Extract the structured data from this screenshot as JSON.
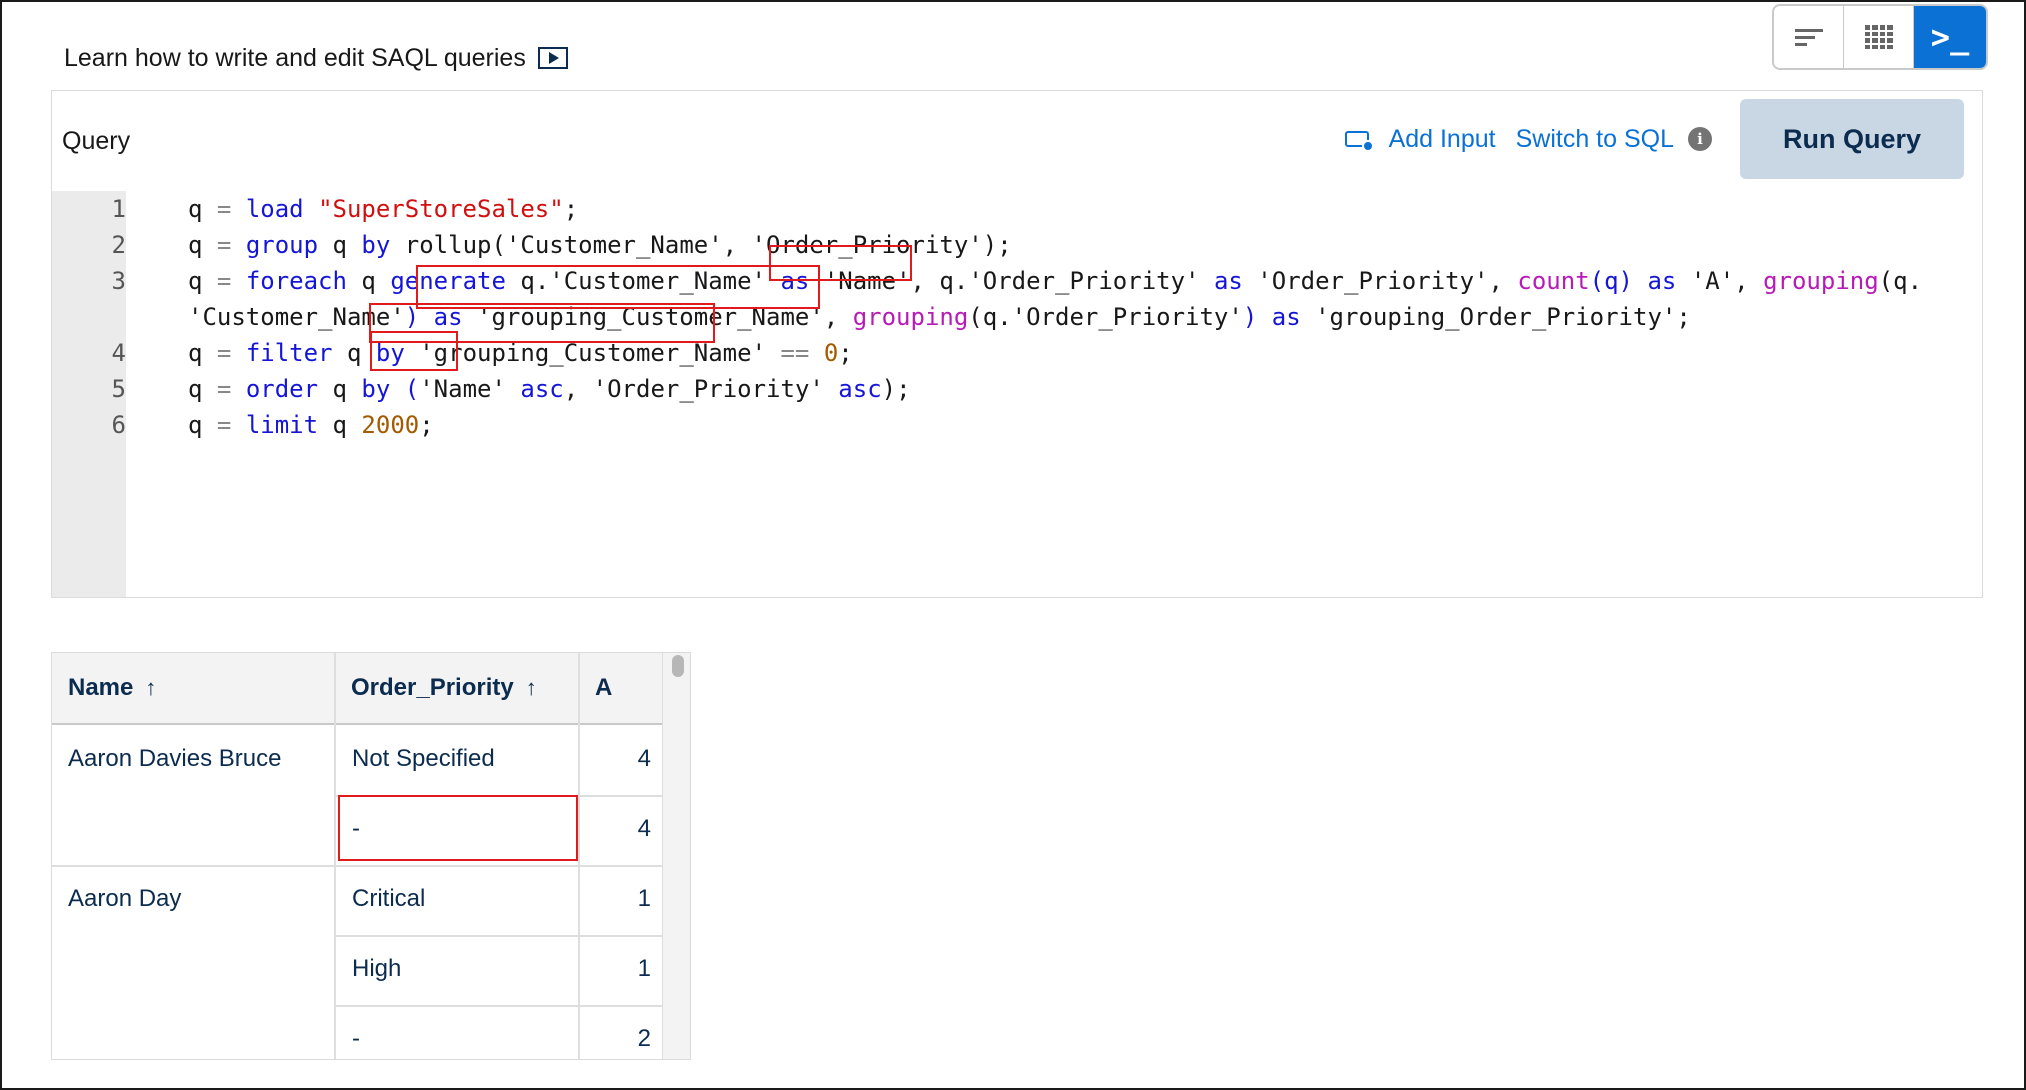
{
  "help": {
    "learn_text": "Learn how to write and edit SAQL queries"
  },
  "toggles": [
    {
      "icon": "sort-icon"
    },
    {
      "icon": "table-icon"
    },
    {
      "icon": "terminal-icon",
      "active": true
    }
  ],
  "query_panel": {
    "title": "Query",
    "add_input_label": "Add Input",
    "switch_sql_label": "Switch to SQL",
    "info_glyph": "i",
    "run_label": "Run Query"
  },
  "editor": {
    "line_numbers": [
      "1",
      "2",
      "3",
      "",
      "4",
      "5",
      "6"
    ],
    "lines": [
      [
        [
          "q ",
          ""
        ],
        [
          "=",
          "op"
        ],
        [
          " ",
          ""
        ],
        [
          "load",
          "kw"
        ],
        [
          " ",
          ""
        ],
        [
          "\"SuperStoreSales\"",
          "str"
        ],
        [
          ";",
          ""
        ]
      ],
      [
        [
          "q ",
          ""
        ],
        [
          "=",
          "op"
        ],
        [
          " ",
          ""
        ],
        [
          "group",
          "kw"
        ],
        [
          " q ",
          ""
        ],
        [
          "by",
          "kw"
        ],
        [
          " rollup('Customer_Name', 'Order_Priority');",
          ""
        ]
      ],
      [
        [
          "q ",
          ""
        ],
        [
          "=",
          "op"
        ],
        [
          " ",
          ""
        ],
        [
          "foreach",
          "kw"
        ],
        [
          " q ",
          ""
        ],
        [
          "generate",
          "kw"
        ],
        [
          " q.'Customer_Name' ",
          ""
        ],
        [
          "as",
          "kw"
        ],
        [
          " 'Name', q.'Order_Priority' ",
          ""
        ],
        [
          "as",
          "kw"
        ],
        [
          " 'Order_Priority', ",
          ""
        ],
        [
          "count",
          "fn"
        ],
        [
          "(q)",
          "kw"
        ],
        [
          " ",
          ""
        ],
        [
          "as",
          "kw"
        ],
        [
          " 'A', ",
          ""
        ],
        [
          "grouping",
          "fn"
        ],
        [
          "(q.",
          ""
        ]
      ],
      [
        [
          "'Customer_Name'",
          ""
        ],
        [
          ")",
          "kw"
        ],
        [
          " ",
          ""
        ],
        [
          "as",
          "kw"
        ],
        [
          " 'grouping_Customer_Name', ",
          ""
        ],
        [
          "grouping",
          "fn"
        ],
        [
          "(q.'Order_Priority'",
          ""
        ],
        [
          ")",
          "kw"
        ],
        [
          " ",
          ""
        ],
        [
          "as",
          "kw"
        ],
        [
          " 'grouping_Order_Priority';",
          ""
        ]
      ],
      [
        [
          "q ",
          ""
        ],
        [
          "=",
          "op"
        ],
        [
          " ",
          ""
        ],
        [
          "filter",
          "kw"
        ],
        [
          " q ",
          ""
        ],
        [
          "by",
          "kw"
        ],
        [
          " 'grouping_Customer_Name' ",
          ""
        ],
        [
          "==",
          "op"
        ],
        [
          " ",
          ""
        ],
        [
          "0",
          "num"
        ],
        [
          ";",
          ""
        ]
      ],
      [
        [
          "q ",
          ""
        ],
        [
          "=",
          "op"
        ],
        [
          " ",
          ""
        ],
        [
          "order",
          "kw"
        ],
        [
          " q ",
          ""
        ],
        [
          "by",
          "kw"
        ],
        [
          " ",
          ""
        ],
        [
          "(",
          "kw"
        ],
        [
          "'Name' ",
          ""
        ],
        [
          "asc",
          "kw"
        ],
        [
          ", 'Order_Priority' ",
          ""
        ],
        [
          "asc",
          "kw"
        ],
        [
          ");",
          ""
        ]
      ],
      [
        [
          "q ",
          ""
        ],
        [
          "=",
          "op"
        ],
        [
          " ",
          ""
        ],
        [
          "limit",
          "kw"
        ],
        [
          " q ",
          ""
        ],
        [
          "2000",
          "num"
        ],
        [
          ";",
          ""
        ]
      ]
    ]
  },
  "results": {
    "columns": [
      {
        "label": "Name",
        "sort": "↑"
      },
      {
        "label": "Order_Priority",
        "sort": "↑"
      },
      {
        "label": "A",
        "sort": ""
      }
    ],
    "groups": [
      {
        "name": "Aaron Davies Bruce",
        "rows": [
          {
            "priority": "Not Specified",
            "a": "4"
          },
          {
            "priority": "-",
            "a": "4"
          }
        ]
      },
      {
        "name": "Aaron Day",
        "rows": [
          {
            "priority": "Critical",
            "a": "1"
          },
          {
            "priority": "High",
            "a": "1"
          },
          {
            "priority": "-",
            "a": "2"
          }
        ]
      }
    ]
  }
}
